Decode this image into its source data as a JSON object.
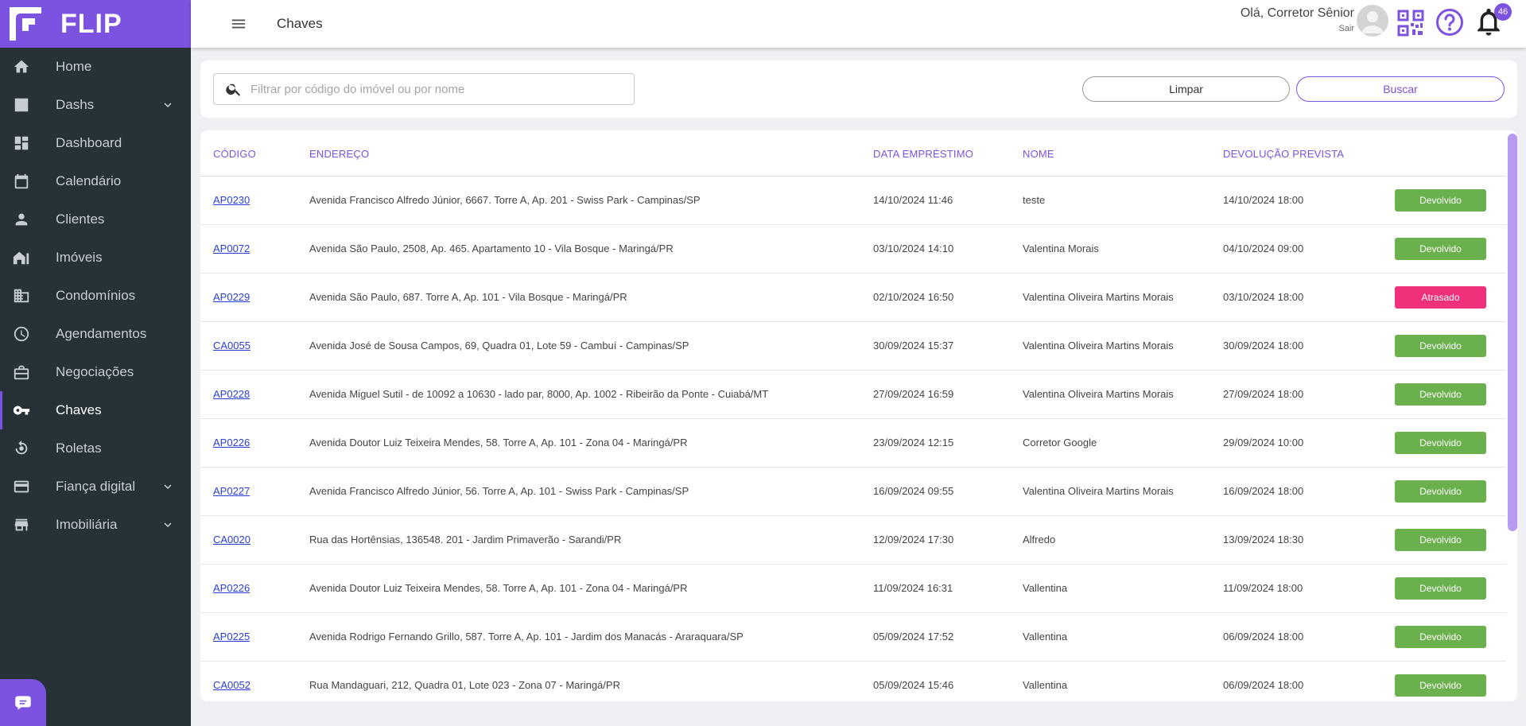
{
  "brand": {
    "name": "FLIP",
    "color": "#7c52e0"
  },
  "sidebar": {
    "items": [
      {
        "label": "Home",
        "icon": "home-icon",
        "expandable": false
      },
      {
        "label": "Dashs",
        "icon": "chart-icon",
        "expandable": true
      },
      {
        "label": "Dashboard",
        "icon": "dashboard-icon",
        "expandable": false
      },
      {
        "label": "Calendário",
        "icon": "calendar-icon",
        "expandable": false
      },
      {
        "label": "Clientes",
        "icon": "person-icon",
        "expandable": false
      },
      {
        "label": "Imóveis",
        "icon": "house-icon",
        "expandable": false
      },
      {
        "label": "Condomínios",
        "icon": "building-icon",
        "expandable": false
      },
      {
        "label": "Agendamentos",
        "icon": "clock-icon",
        "expandable": false
      },
      {
        "label": "Negociações",
        "icon": "briefcase-icon",
        "expandable": false
      },
      {
        "label": "Chaves",
        "icon": "key-icon",
        "expandable": false,
        "active": true
      },
      {
        "label": "Roletas",
        "icon": "roulette-icon",
        "expandable": false
      },
      {
        "label": "Fiança digital",
        "icon": "credit-card-icon",
        "expandable": true
      },
      {
        "label": "Imobiliária",
        "icon": "store-icon",
        "expandable": true
      }
    ]
  },
  "topbar": {
    "title": "Chaves",
    "greeting": "Olá, Corretor Sênior",
    "logout": "Sair",
    "notifications_count": "46"
  },
  "filter": {
    "placeholder": "Filtrar por código do imóvel ou por nome",
    "value": "",
    "clear_label": "Limpar",
    "search_label": "Buscar"
  },
  "table": {
    "headers": {
      "code": "CÓDIGO",
      "address": "ENDEREÇO",
      "loan_date": "DATA EMPRÉSTIMO",
      "name": "NOME",
      "return_date": "DEVOLUÇÃO PREVISTA"
    },
    "status_colors": {
      "Devolvido": "#6ab04c",
      "Atrasado": "#f0307b"
    },
    "rows": [
      {
        "code": "AP0230",
        "address": "Avenida Francisco Alfredo Júnior, 6667. Torre A, Ap. 201 - Swiss Park - Campinas/SP",
        "loan_date": "14/10/2024 11:46",
        "name": "teste",
        "return_date": "14/10/2024 18:00",
        "status": "Devolvido"
      },
      {
        "code": "AP0072",
        "address": "Avenida São Paulo, 2508, Ap. 465. Apartamento 10 - Vila Bosque - Maringá/PR",
        "loan_date": "03/10/2024 14:10",
        "name": "Valentina Morais",
        "return_date": "04/10/2024 09:00",
        "status": "Devolvido"
      },
      {
        "code": "AP0229",
        "address": "Avenida São Paulo, 687. Torre A, Ap. 101 - Vila Bosque - Maringá/PR",
        "loan_date": "02/10/2024 16:50",
        "name": "Valentina Oliveira Martins Morais",
        "return_date": "03/10/2024 18:00",
        "status": "Atrasado"
      },
      {
        "code": "CA0055",
        "address": "Avenida José de Sousa Campos, 69, Quadra 01, Lote 59 - Cambuí - Campinas/SP",
        "loan_date": "30/09/2024 15:37",
        "name": "Valentina Oliveira Martins Morais",
        "return_date": "30/09/2024 18:00",
        "status": "Devolvido"
      },
      {
        "code": "AP0228",
        "address": "Avenida Miguel Sutil - de 10092 a 10630 - lado par, 8000, Ap. 1002 - Ribeirão da Ponte - Cuiabá/MT",
        "loan_date": "27/09/2024 16:59",
        "name": "Valentina Oliveira Martins Morais",
        "return_date": "27/09/2024 18:00",
        "status": "Devolvido"
      },
      {
        "code": "AP0226",
        "address": "Avenida Doutor Luiz Teixeira Mendes, 58. Torre A, Ap. 101 - Zona 04 - Maringá/PR",
        "loan_date": "23/09/2024 12:15",
        "name": "Corretor Google",
        "return_date": "29/09/2024 10:00",
        "status": "Devolvido"
      },
      {
        "code": "AP0227",
        "address": "Avenida Francisco Alfredo Júnior, 56. Torre A, Ap. 101 - Swiss Park - Campinas/SP",
        "loan_date": "16/09/2024 09:55",
        "name": "Valentina Oliveira Martins Morais",
        "return_date": "16/09/2024 18:00",
        "status": "Devolvido"
      },
      {
        "code": "CA0020",
        "address": "Rua das Hortênsias, 136548. 201 - Jardim Primaverão - Sarandi/PR",
        "loan_date": "12/09/2024 17:30",
        "name": "Alfredo",
        "return_date": "13/09/2024 18:30",
        "status": "Devolvido"
      },
      {
        "code": "AP0226",
        "address": "Avenida Doutor Luiz Teixeira Mendes, 58. Torre A, Ap. 101 - Zona 04 - Maringá/PR",
        "loan_date": "11/09/2024 16:31",
        "name": "Vallentina",
        "return_date": "11/09/2024 18:00",
        "status": "Devolvido"
      },
      {
        "code": "AP0225",
        "address": "Avenida Rodrigo Fernando Grillo, 587. Torre A, Ap. 101 - Jardim dos Manacás - Araraquara/SP",
        "loan_date": "05/09/2024 17:52",
        "name": "Vallentina",
        "return_date": "06/09/2024 18:00",
        "status": "Devolvido"
      },
      {
        "code": "CA0052",
        "address": "Rua Mandaguari, 212, Quadra 01, Lote 023 - Zona 07 - Maringá/PR",
        "loan_date": "05/09/2024 15:46",
        "name": "Vallentina",
        "return_date": "06/09/2024 18:00",
        "status": "Devolvido"
      }
    ]
  }
}
